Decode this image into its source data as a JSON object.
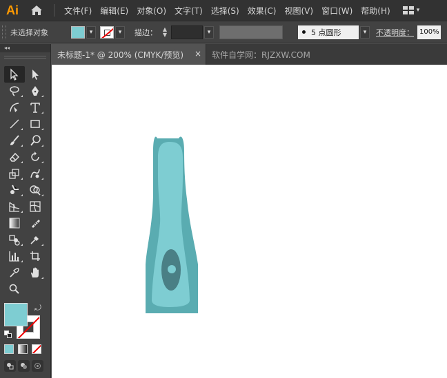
{
  "app": {
    "logo": "Ai"
  },
  "menu": {
    "items": [
      "文件(F)",
      "编辑(E)",
      "对象(O)",
      "文字(T)",
      "选择(S)",
      "效果(C)",
      "视图(V)",
      "窗口(W)",
      "帮助(H)"
    ]
  },
  "control": {
    "selection_label": "未选择对象",
    "stroke_label": "描边：",
    "brush_value": "5 点圆形",
    "opacity_label": "不透明度：",
    "opacity_value": "100%"
  },
  "tabs": {
    "active": "未标题-1* @ 200% (CMYK/预览)",
    "close": "×",
    "inactive": "软件自学网：RJZXW.COM"
  },
  "toolbar": {
    "collapse": "◂◂"
  },
  "colors": {
    "fill": "#7ecdd2",
    "artwork_dark": "#5aacb1",
    "artwork_light": "#7ecdd2",
    "artwork_oval": "#4a7f85"
  },
  "icons": [
    "home-icon",
    "workspace-switcher-icon",
    "selection-tool-icon",
    "direct-selection-tool-icon",
    "lasso-tool-icon",
    "pen-tool-icon",
    "curvature-tool-icon",
    "type-tool-icon",
    "line-tool-icon",
    "rectangle-tool-icon",
    "paintbrush-tool-icon",
    "blob-brush-tool-icon",
    "eraser-tool-icon",
    "rotate-tool-icon",
    "scale-tool-icon",
    "warp-tool-icon",
    "puppet-warp-tool-icon",
    "shape-builder-tool-icon",
    "perspective-grid-tool-icon",
    "mesh-tool-icon",
    "gradient-tool-icon",
    "slice-tool-icon",
    "blend-tool-icon",
    "eyedropper-tool-icon",
    "graph-tool-icon",
    "artboard-tool-icon",
    "eyedropper-small-icon",
    "hand-tool-icon",
    "zoom-tool-icon"
  ]
}
